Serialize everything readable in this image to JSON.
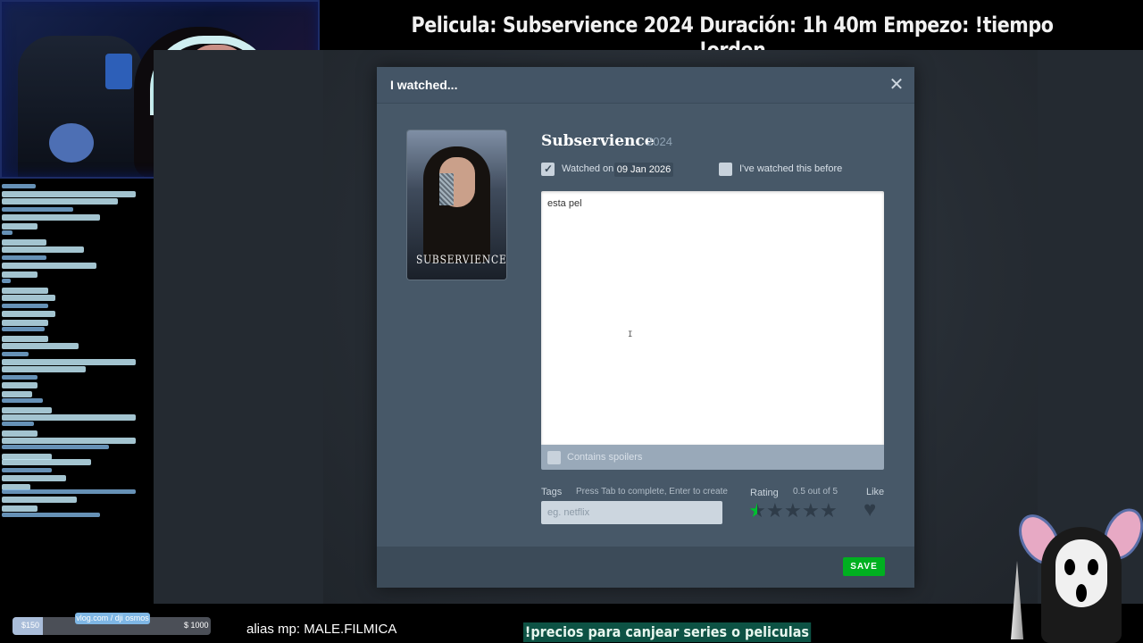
{
  "overlay": {
    "title": "Pelicula: Subservience 2024 Duración: 1h 40m Empezo: !tiempo !orden",
    "alias": "alias mp: MALE.FILMICA",
    "redeem": "!precios para canjear series o peliculas"
  },
  "goal": {
    "min": "$150",
    "max": "$ 1000",
    "title": "vlog.com / dji osmos"
  },
  "modal": {
    "title": "I watched...",
    "close_icon": "close-icon",
    "film": {
      "title": "Subservience",
      "year": "2024",
      "poster_title": "SUBSERVIENCE"
    },
    "watched_on_label": "Watched on",
    "watched_on_checked": true,
    "watched_date": "09 Jan 2026",
    "rewatch_label": "I've watched this before",
    "rewatch_checked": false,
    "review_text": "esta pel",
    "spoilers_label": "Contains spoilers",
    "spoilers_checked": false,
    "tags_label": "Tags",
    "tags_hint": "Press Tab to complete, Enter to create",
    "tags_placeholder": "eg. netflix",
    "rating_label": "Rating",
    "rating_value_text": "0.5 out of 5",
    "rating": 0.5,
    "rating_max": 5,
    "like_label": "Like",
    "liked": false,
    "save_label": "SAVE"
  },
  "colors": {
    "save_green": "#00b020",
    "star_active": "#00c030",
    "star_inactive": "#2f3c49",
    "modal_bg": "#445566"
  }
}
